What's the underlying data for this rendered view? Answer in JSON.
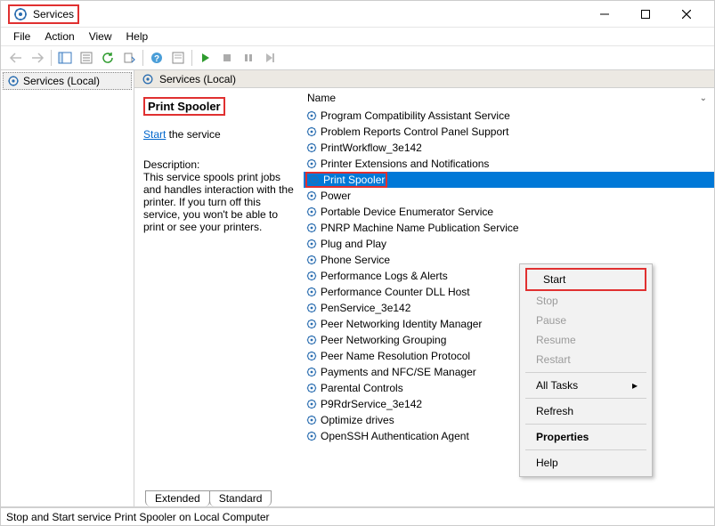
{
  "window": {
    "title": "Services"
  },
  "menubar": [
    "File",
    "Action",
    "View",
    "Help"
  ],
  "left_tree": {
    "root": "Services (Local)"
  },
  "pane": {
    "header": "Services (Local)"
  },
  "columns": {
    "name": "Name"
  },
  "detail": {
    "title": "Print Spooler",
    "link_label": "Start",
    "link_suffix": " the service",
    "desc_label": "Description:",
    "desc": "This service spools print jobs and handles interaction with the printer. If you turn off this service, you won't be able to print or see your printers."
  },
  "services": [
    "Program Compatibility Assistant Service",
    "Problem Reports Control Panel Support",
    "PrintWorkflow_3e142",
    "Printer Extensions and Notifications",
    "Print Spooler",
    "Power",
    "Portable Device Enumerator Service",
    "PNRP Machine Name Publication Service",
    "Plug and Play",
    "Phone Service",
    "Performance Logs & Alerts",
    "Performance Counter DLL Host",
    "PenService_3e142",
    "Peer Networking Identity Manager",
    "Peer Networking Grouping",
    "Peer Name Resolution Protocol",
    "Payments and NFC/SE Manager",
    "Parental Controls",
    "P9RdrService_3e142",
    "Optimize drives",
    "OpenSSH Authentication Agent"
  ],
  "selected_index": 4,
  "tabs": {
    "extended": "Extended",
    "standard": "Standard"
  },
  "statusbar": "Stop and Start service Print Spooler on Local Computer",
  "context_menu": {
    "start": "Start",
    "stop": "Stop",
    "pause": "Pause",
    "resume": "Resume",
    "restart": "Restart",
    "all_tasks": "All Tasks",
    "refresh": "Refresh",
    "properties": "Properties",
    "help": "Help"
  }
}
